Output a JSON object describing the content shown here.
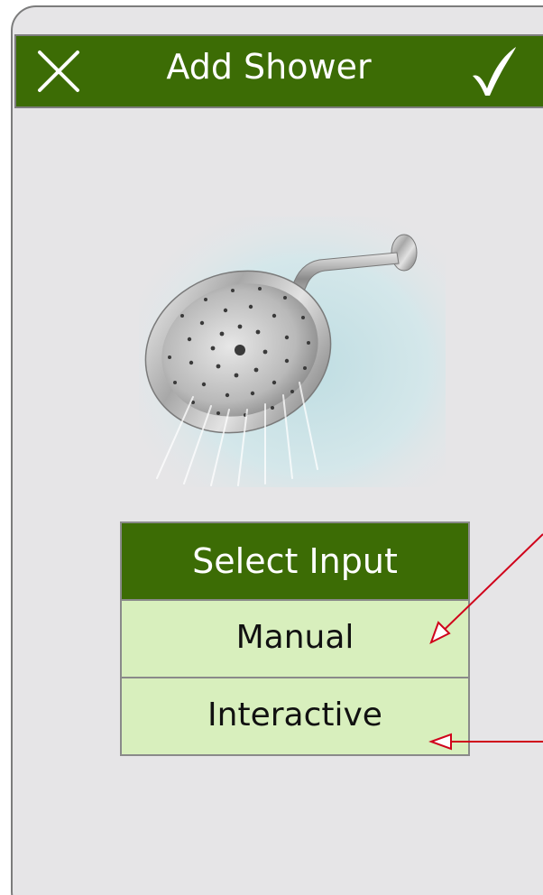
{
  "header": {
    "title": "Add Shower",
    "close_icon": "close-x-icon",
    "confirm_icon": "checkmark-icon"
  },
  "image": {
    "subject": "shower-head-photo"
  },
  "input_menu": {
    "title": "Select Input",
    "options": [
      "Manual",
      "Interactive"
    ]
  },
  "colors": {
    "header_green": "#3c6c05",
    "option_green": "#d8efbd",
    "screen_bg": "#e6e5e7",
    "annotation_red": "#d0021b"
  }
}
